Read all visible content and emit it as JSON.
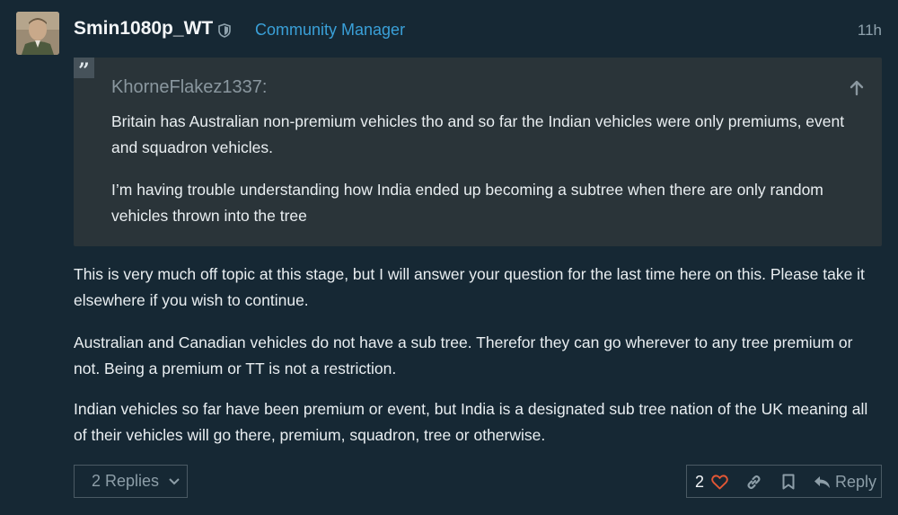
{
  "post": {
    "username": "Smin1080p_WT",
    "role": "Community Manager",
    "time": "11h",
    "quote": {
      "author": "KhorneFlakez1337:",
      "paragraphs": [
        "Britain has Australian non-premium vehicles tho and so far the Indian vehicles were only premiums, event and squadron vehicles.",
        "I’m having trouble understanding how India ended up becoming a subtree when there are only random vehicles thrown into the tree"
      ]
    },
    "paragraphs": [
      "This is very much off topic at this stage, but I will answer your question for the last time here on this. Please take it elsewhere if you wish to continue.",
      "Australian and Canadian vehicles do not have a sub tree. Therefor they can go wherever to any tree premium or not. Being a premium or TT is not a restriction.",
      "Indian vehicles so far have been premium or event, but India is a designated sub tree nation of the UK meaning all of their vehicles will go there, premium, squadron, tree or otherwise."
    ]
  },
  "footer": {
    "replies_label": "2 Replies",
    "like_count": "2",
    "reply_label": "Reply"
  },
  "icons": {
    "shield": "shield-icon",
    "quote": "quote-icon",
    "up_arrow": "arrow-up-icon",
    "chevron": "chevron-down-icon",
    "heart": "heart-icon",
    "link": "link-icon",
    "bookmark": "bookmark-icon",
    "reply": "reply-icon"
  },
  "colors": {
    "background": "#162834",
    "quote_background": "#2a3439",
    "accent": "#3aa0d8",
    "heart": "#e45735"
  }
}
